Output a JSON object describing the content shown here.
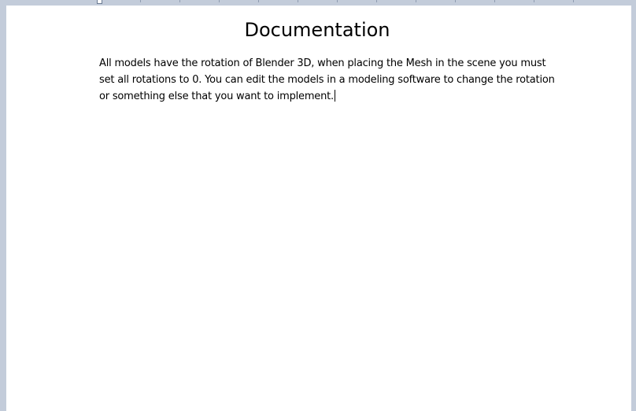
{
  "document": {
    "title": "Documentation",
    "body_lines": [
      "All models have the rotation of Blender 3D, when placing the Mesh in the scene you must",
      "set all rotations to 0. You can edit the models in a modeling software to change the rotation",
      "or something else that you want to implement."
    ]
  },
  "colors": {
    "workspace_background": "#c3ccda",
    "page_background": "#ffffff",
    "text": "#000000"
  }
}
